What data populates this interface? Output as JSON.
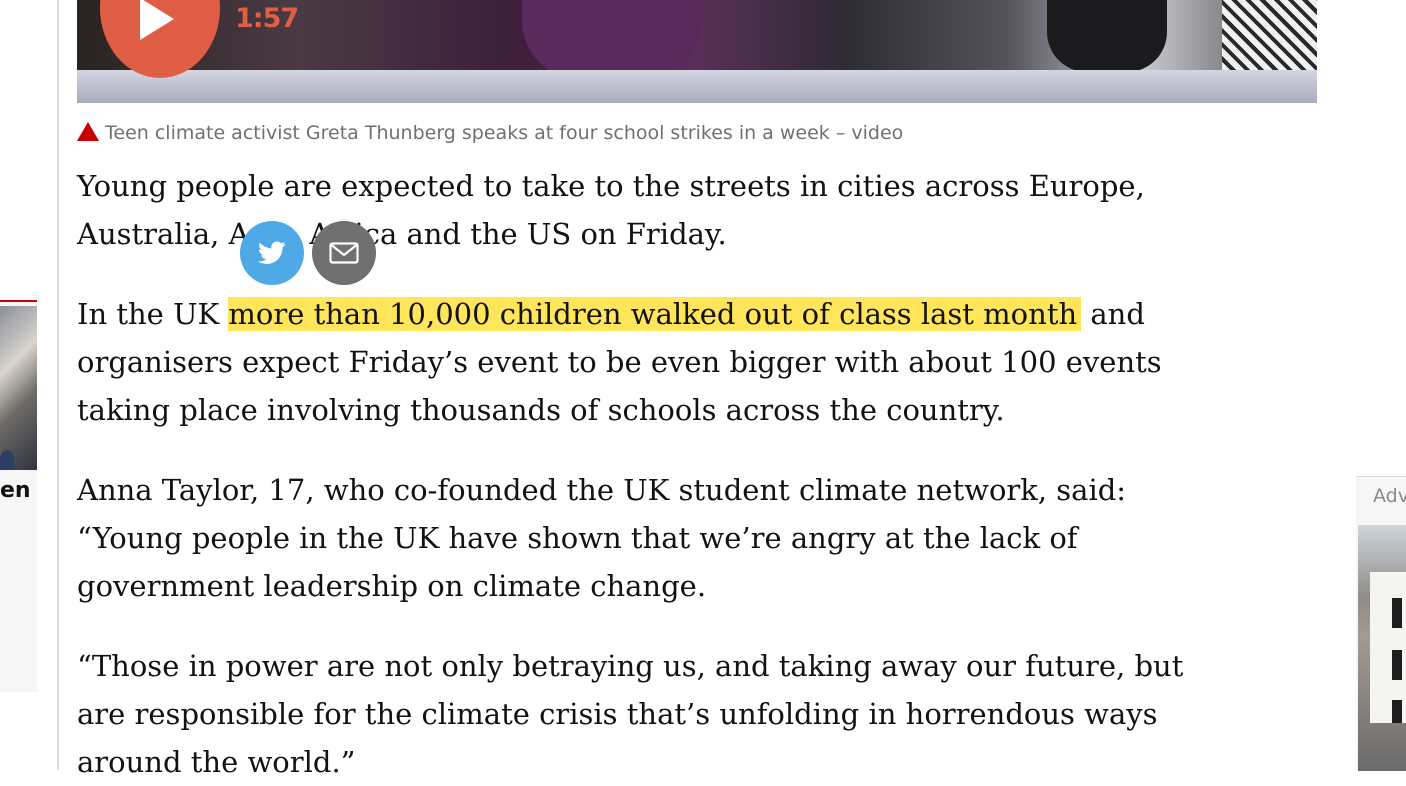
{
  "video": {
    "duration": "1:57"
  },
  "caption": {
    "text": "Teen climate activist Greta Thunberg speaks at four school strikes in a week – video"
  },
  "article": {
    "p1_line1": "Young people are expected to take to the streets in cities across Europe,",
    "p1_line2": "Australia, Asia, Africa and the US on Friday.",
    "p2_before": "In the UK ",
    "p2_link": "more than 10,000 children walked out of class last month",
    "p2_after": " and",
    "p2_line2": "organisers expect Friday’s event to be even bigger with about 100 events",
    "p2_line3": "taking place involving thousands of schools across the country.",
    "p3_line1": "Anna Taylor, 17, who co-founded the UK student climate network, said:",
    "p3_line2": "“Young people in the UK have shown that we’re angry at the lack of",
    "p3_line3": "government leadership on climate change.",
    "p4_line1": "“Those in power are not only betraying us, and taking away our future, but",
    "p4_line2": "are responsible for the climate crisis that’s unfolding in horrendous ways",
    "p4_line3": "around the world.”"
  },
  "left_card": {
    "text_fragment": "en"
  },
  "ad": {
    "label": "Adv"
  },
  "share": {
    "twitter_icon": "twitter-icon",
    "email_icon": "email-icon"
  },
  "colors": {
    "highlight": "#ffe55a",
    "play_button": "#e05e45",
    "twitter": "#4fa9e6",
    "email": "#707070",
    "caption_triangle": "#c70000"
  }
}
